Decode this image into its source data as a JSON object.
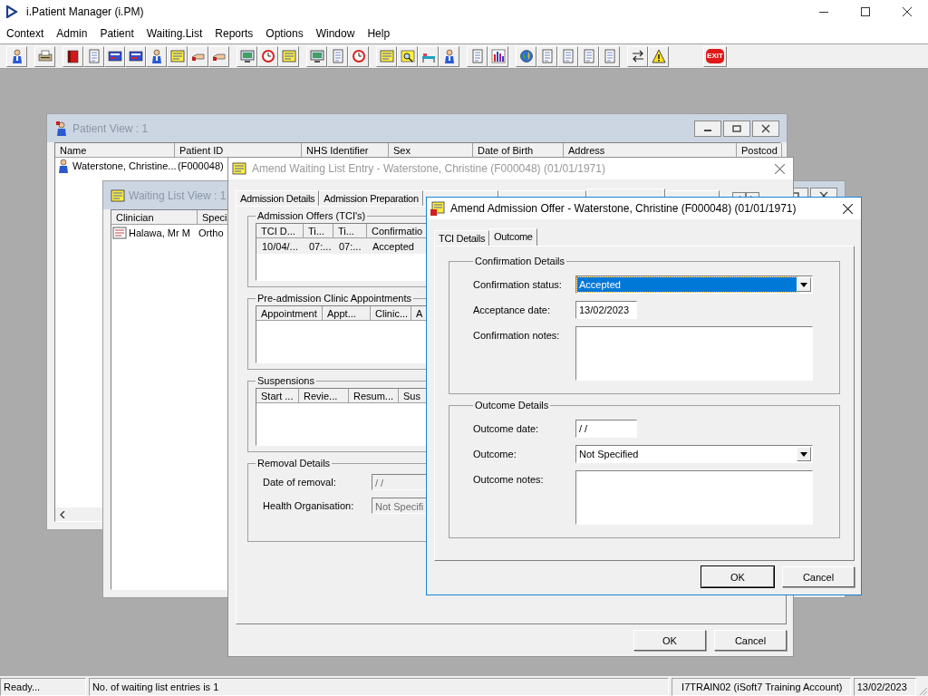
{
  "app": {
    "title": "i.Patient Manager (i.PM)"
  },
  "menu": [
    "Context",
    "Admin",
    "Patient",
    "Waiting.List",
    "Reports",
    "Options",
    "Window",
    "Help"
  ],
  "toolbar": {
    "exit_label": "EXIT"
  },
  "patient_view": {
    "title": "Patient View : 1",
    "active": false,
    "columns": [
      "Name",
      "Patient ID",
      "NHS Identifier",
      "Sex",
      "Date of Birth",
      "Address",
      "Postcod"
    ],
    "rows": [
      [
        "Waterstone, Christine...",
        "(F000048)"
      ]
    ]
  },
  "waiting_list_view": {
    "title": "Waiting List View : 1",
    "active": false,
    "columns": [
      "Clinician",
      "Speci"
    ],
    "rows": [
      [
        "Halawa, Mr M",
        "Ortho"
      ]
    ]
  },
  "amend_entry": {
    "title": "Amend Waiting List Entry - Waterstone, Christine (F000048) (01/01/1971)",
    "active": false,
    "tabs": [
      {
        "label": "Admission Details",
        "selected": false
      },
      {
        "label": "Admission Preparation",
        "selected": false
      },
      {
        "selected": false
      },
      {
        "selected": false
      },
      {
        "selected": true
      },
      {
        "selected": false
      }
    ],
    "tables": [
      {
        "legend": "Admission Offers (TCI's)",
        "columns": [
          "TCI D...",
          "Ti...",
          "Ti...",
          "Confirmatio"
        ],
        "rows": [
          [
            "10/04/...",
            "07:...",
            "07:...",
            "Accepted"
          ]
        ]
      },
      {
        "legend": "Pre-admission Clinic Appointments",
        "columns": [
          "Appointment",
          "Appt...",
          "Clinic...",
          "A"
        ]
      },
      {
        "legend": "Suspensions",
        "columns": [
          "Start ...",
          "Revie...",
          "Resum...",
          "Sus"
        ]
      }
    ],
    "removal": {
      "legend": "Removal Details",
      "fields": [
        {
          "label": "Date of removal:",
          "value": "/ /"
        },
        {
          "label": "Health Organisation:",
          "value": "Not Specifi"
        }
      ]
    },
    "buttons": [
      "OK",
      "Cancel"
    ]
  },
  "offer_dialog": {
    "title": "Amend Admission Offer  - Waterstone, Christine (F000048) (01/01/1971)",
    "active": true,
    "tabs": [
      {
        "label": "TCI Details",
        "selected": false
      },
      {
        "label": "Outcome",
        "selected": true
      }
    ],
    "groups": [
      {
        "legend": "Confirmation Details",
        "fields": [
          {
            "kind": "dropdown",
            "label": "Confirmation status:",
            "value": "Accepted",
            "focused": true
          },
          {
            "kind": "date",
            "label": "Acceptance date:",
            "value": "13/02/2023"
          },
          {
            "kind": "notes",
            "label": "Confirmation notes:"
          }
        ]
      },
      {
        "legend": "Outcome Details",
        "fields": [
          {
            "kind": "date",
            "label": "Outcome date:",
            "value": "/ /"
          },
          {
            "kind": "dropdown",
            "label": "Outcome:",
            "value": "Not Specified",
            "focused": false
          },
          {
            "kind": "notes",
            "label": "Outcome notes:"
          }
        ]
      }
    ],
    "buttons": [
      "OK",
      "Cancel"
    ]
  },
  "status_bar": [
    "Ready...",
    "No. of waiting list entries is 1",
    "I7TRAIN02 (iSoft7 Training Account)",
    "13/02/2023"
  ]
}
